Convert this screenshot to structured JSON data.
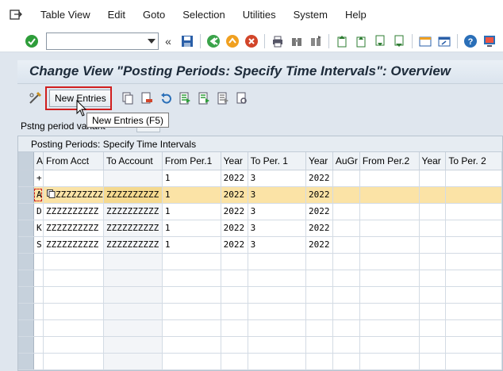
{
  "menu": {
    "items": [
      {
        "name": "table-view",
        "label": "Table View"
      },
      {
        "name": "edit",
        "label": "Edit"
      },
      {
        "name": "goto",
        "label": "Goto"
      },
      {
        "name": "selection",
        "label": "Selection"
      },
      {
        "name": "utilities",
        "label": "Utilities"
      },
      {
        "name": "system",
        "label": "System"
      },
      {
        "name": "help",
        "label": "Help"
      }
    ]
  },
  "command_field": {
    "value": "",
    "placeholder": ""
  },
  "title": "Change View \"Posting Periods: Specify Time Intervals\": Overview",
  "app_toolbar": {
    "new_entries_label": "New Entries",
    "tooltip": "New Entries   (F5)"
  },
  "field": {
    "label": "Pstng period variant",
    "value": ""
  },
  "table": {
    "title": "Posting Periods: Specify Time Intervals",
    "columns": [
      "A",
      "From Acct",
      "To Account",
      "From Per.1",
      "Year",
      "To Per. 1",
      "Year",
      "AuGr",
      "From Per.2",
      "Year",
      "To Per. 2"
    ],
    "rows": [
      [
        "+",
        "",
        "",
        "1",
        "2022",
        "3",
        "2022",
        "",
        "",
        "",
        ""
      ],
      [
        "A",
        "ZZZZZZZZZ",
        "ZZZZZZZZZZ",
        "1",
        "2022",
        "3",
        "2022",
        "",
        "",
        "",
        ""
      ],
      [
        "D",
        "ZZZZZZZZZZ",
        "ZZZZZZZZZZ",
        "1",
        "2022",
        "3",
        "2022",
        "",
        "",
        "",
        ""
      ],
      [
        "K",
        "ZZZZZZZZZZ",
        "ZZZZZZZZZZ",
        "1",
        "2022",
        "3",
        "2022",
        "",
        "",
        "",
        ""
      ],
      [
        "S",
        "ZZZZZZZZZZ",
        "ZZZZZZZZZZ",
        "1",
        "2022",
        "3",
        "2022",
        "",
        "",
        "",
        ""
      ]
    ],
    "selected_row": 1,
    "empty_rows": 7
  },
  "colors": {
    "selected_row": "#fbe3a6",
    "highlight": "#d01e1e",
    "title_text": "#1d2b3a"
  }
}
